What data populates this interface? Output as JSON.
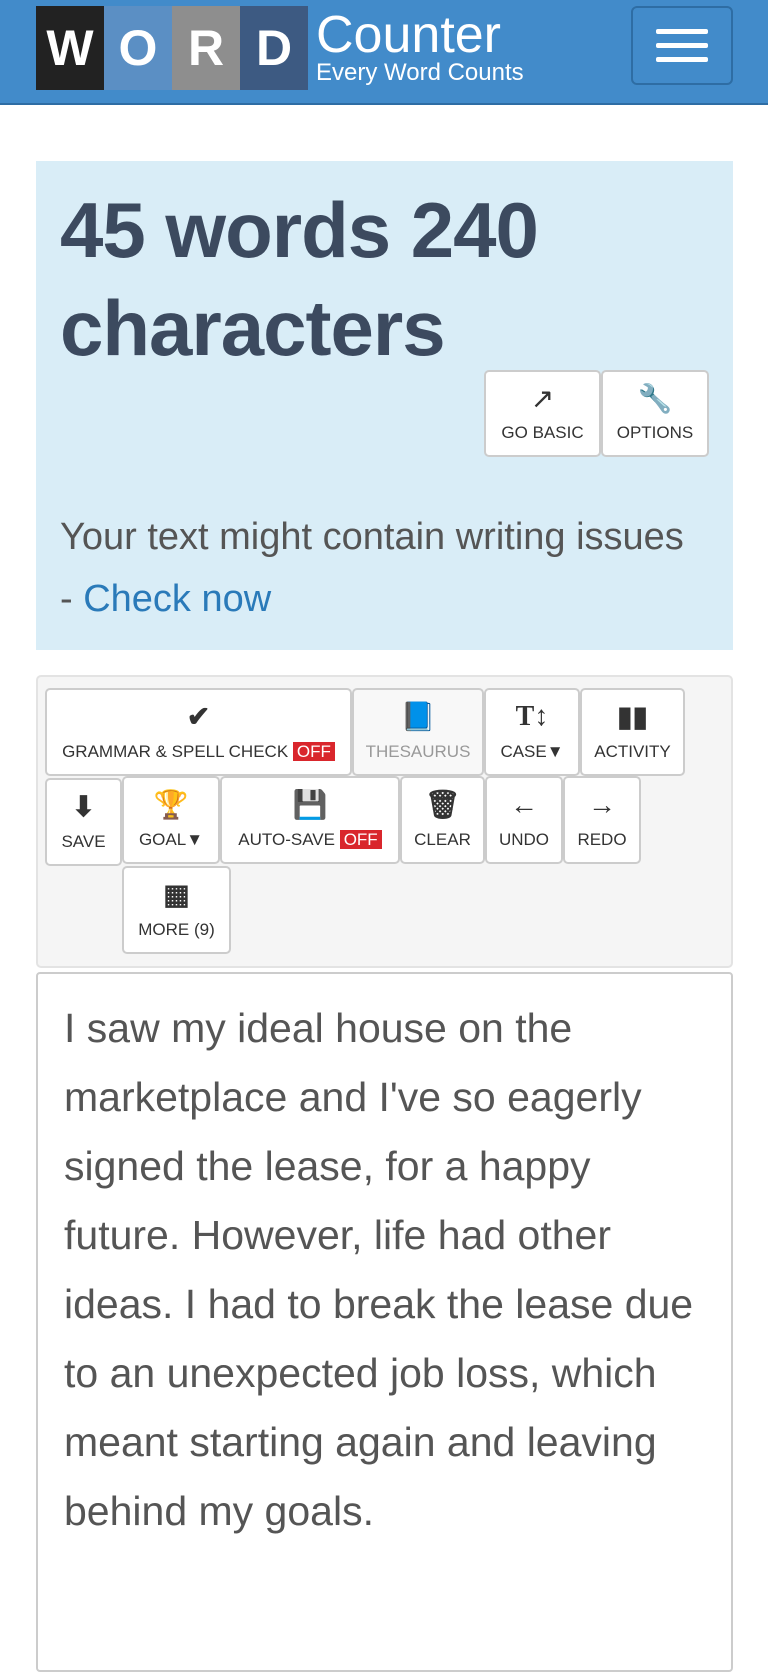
{
  "header": {
    "logo_letters": [
      "W",
      "O",
      "R",
      "D"
    ],
    "logo_colors": [
      "#222222",
      "#5b8fc4",
      "#8e8e8e",
      "#3d5a82"
    ],
    "brand_name": "Counter",
    "tagline": "Every Word Counts",
    "menu_icon": "hamburger-icon"
  },
  "stats": {
    "summary": "45 words 240 characters",
    "words": 45,
    "characters": 240
  },
  "hero_buttons": [
    {
      "label": "GO BASIC",
      "icon": "external-link-icon"
    },
    {
      "label": "OPTIONS",
      "icon": "wrench-icon"
    }
  ],
  "issues": {
    "text": "Your text might contain writing issues",
    "separator": "- ",
    "link": "Check now"
  },
  "toolbar": {
    "grammar": {
      "label": "GRAMMAR & SPELL CHECK",
      "state": "OFF"
    },
    "thesaurus": "THESAURUS",
    "case": "CASE",
    "activity": "ACTIVITY",
    "save": "SAVE",
    "goal": "GOAL",
    "autosave": {
      "label": "AUTO-SAVE",
      "state": "OFF"
    },
    "clear": "CLEAR",
    "undo": "UNDO",
    "redo": "REDO",
    "more": "MORE (9)"
  },
  "editor": {
    "text": "I saw my ideal house on the marketplace and I've so eagerly signed the lease, for a happy future. However, life had other ideas. I had to break the lease due to an unexpected job loss, which meant starting again and leaving behind my goals."
  },
  "colors": {
    "header": "#428bca",
    "hero": "#d9edf7",
    "off_badge": "#d9262c",
    "link": "#2a7ab9"
  }
}
